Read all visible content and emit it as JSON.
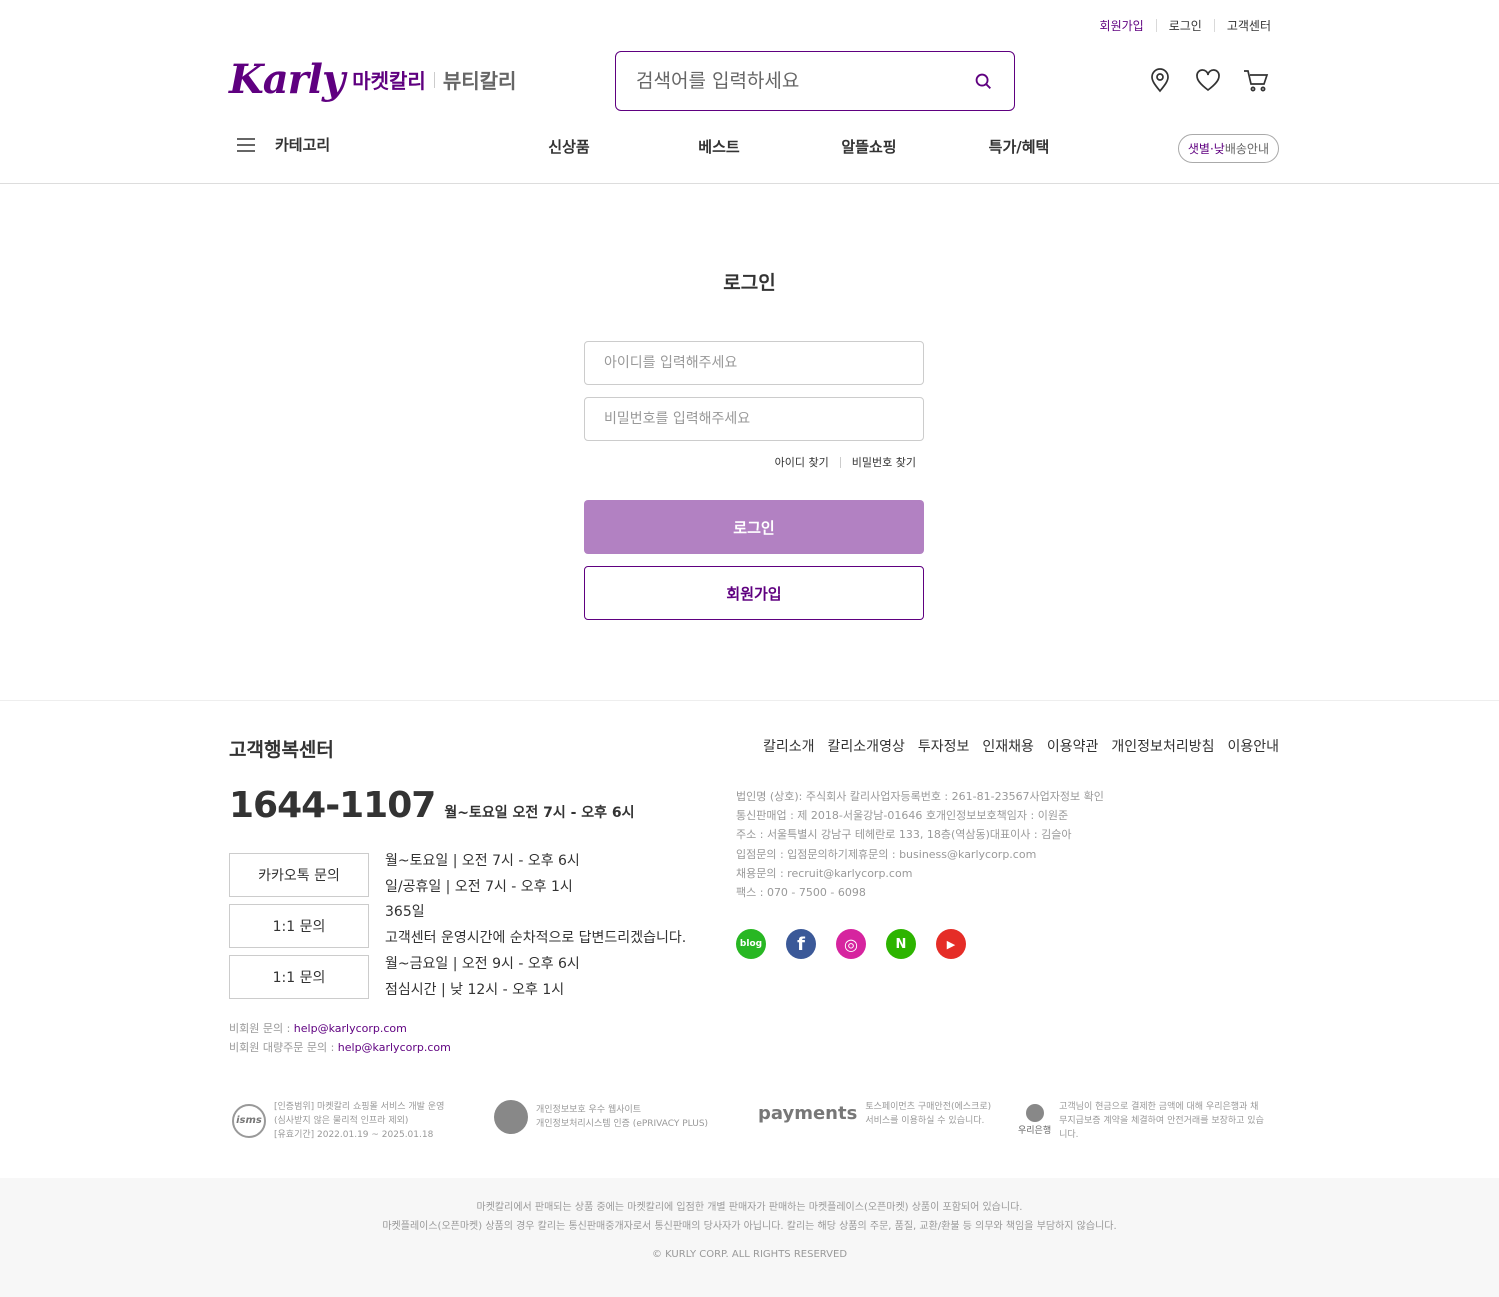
{
  "header": {
    "top_links": {
      "signup": "회원가입",
      "login": "로그인",
      "cs": "고객센터"
    },
    "logo": {
      "brand": "Karly",
      "market": "마켓칼리",
      "beauty": "뷰티칼리"
    },
    "search": {
      "placeholder": "검색어를 입력하세요"
    },
    "icons": [
      "location-icon",
      "heart-icon",
      "cart-icon"
    ],
    "nav": {
      "category": "카테고리",
      "items": [
        "신상품",
        "베스트",
        "알뜰쇼핑",
        "특가/혜택"
      ],
      "delivery_highlight": "샛별·낮",
      "delivery_rest": "배송안내"
    }
  },
  "login": {
    "title": "로그인",
    "id_placeholder": "아이디를 입력해주세요",
    "pw_placeholder": "비밀번호를 입력해주세요",
    "find_id": "아이디 찾기",
    "find_pw": "비밀번호 찾기",
    "login_button": "로그인",
    "signup_button": "회원가입"
  },
  "footer": {
    "cs_title": "고객행복센터",
    "phone": "1644-1107",
    "phone_hours": "월~토요일 오전 7시 - 오후 6시",
    "inquiries": [
      {
        "label": "카카오톡 문의",
        "lines": [
          "월~토요일 | 오전 7시 - 오후 6시",
          "일/공휴일 | 오전 7시 - 오후 1시"
        ]
      },
      {
        "label": "1:1 문의",
        "lines": [
          "365일",
          "고객센터 운영시간에 순차적으로 답변드리겠습니다."
        ]
      },
      {
        "label": "1:1 문의",
        "lines": [
          "월~금요일 | 오전 9시 - 오후 6시",
          "점심시간 | 낮 12시 - 오후 1시"
        ]
      }
    ],
    "nonmember_label": "비회원 문의 : ",
    "nonmember_email": "help@karlycorp.com",
    "bulk_label": "비회원 대량주문 문의 : ",
    "bulk_email": "help@karlycorp.com",
    "links": [
      "칼리소개",
      "칼리소개영상",
      "투자정보",
      "인재채용",
      "이용약관",
      "개인정보처리방침",
      "이용안내"
    ],
    "corp_lines": [
      "법인명 (상호): 주식회사 칼리사업자등록번호 : 261-81-23567사업자정보 확인",
      "통신판매업 : 제 2018-서울강남-01646 호개인정보보호책임자 : 이원준",
      "주소 : 서울특별시 강남구 테헤란로 133, 18층(역삼동)대표이사 : 김슬아",
      "입점문의 : 입점문의하기제휴문의 : business@karlycorp.com",
      "채용문의 : recruit@karlycorp.com",
      "팩스 : 070 - 7500 - 6098"
    ],
    "sns": [
      {
        "name": "blog-icon",
        "color": "#28b723",
        "label": "blog"
      },
      {
        "name": "facebook-icon",
        "color": "#3b5998",
        "label": "f"
      },
      {
        "name": "instagram-icon",
        "color": "#d6249f",
        "label": "◎"
      },
      {
        "name": "naver-post-icon",
        "color": "#2db400",
        "label": "N"
      },
      {
        "name": "youtube-icon",
        "color": "#e52d27",
        "label": "▶"
      }
    ],
    "certs": {
      "isms_badge": "isms",
      "isms_text": [
        "[인증범위] 마켓칼리 쇼핑몰 서비스 개발 운영",
        "(심사받지 않은 물리적 인프라 제외)",
        "[유효기간] 2022.01.19 ~ 2025.01.18"
      ],
      "privacy_text": [
        "개인정보보호 우수 웹사이트",
        "개인정보처리시스템 인증 (ePRIVACY PLUS)"
      ],
      "payments_logo": "payments",
      "payments_text": [
        "토스페이먼츠 구매안전(에스크로)",
        "서비스를 이용하실 수 있습니다."
      ],
      "woori_logo": "우리은행",
      "woori_text": [
        "고객님이 현금으로 결제한 금액에 대해 우리은행과 채",
        "무지급보증 계약을 체결하여 안전거래를 보장하고 있습",
        "니다."
      ]
    },
    "disclaimer": [
      "마켓칼리에서 판매되는 상품 중에는 마켓칼리에 입점한 개별 판매자가 판매하는 마켓플레이스(오픈마켓) 상품이 포함되어 있습니다.",
      "마켓플레이스(오픈마켓) 상품의 경우 칼리는 통신판매중개자로서 통신판매의 당사자가 아닙니다. 칼리는 해당 상품의 주문, 품질, 교환/환불 등 의무와 책임을 부담하지 않습니다."
    ],
    "copyright": "© KURLY CORP. ALL RIGHTS RESERVED"
  },
  "colors": {
    "brand": "#5f0080",
    "login_button": "#b281c2"
  }
}
